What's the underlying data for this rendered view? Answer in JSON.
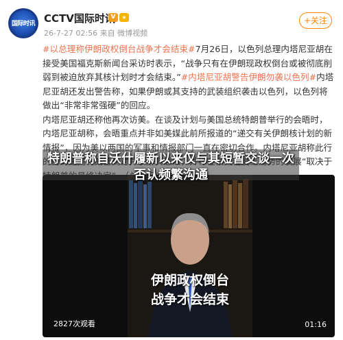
{
  "account": {
    "name": "CCTV国际时讯",
    "avatar_text": "国际时讯",
    "meta": "26-7-27 02:56 来自 微博视频",
    "follow_label": "+关注"
  },
  "post": {
    "tag1": "#以总理称伊朗政权倒台战争才会结束#",
    "p1a": "7月26日，以色列总理内塔尼亚胡在接受美国福克斯新闻台采访时表示，“战争只有在伊朗现政权倒台或被彻底削弱到被迫放弃其核计划时才会结束。”",
    "tag2": "#内塔尼亚胡警告伊朗勿袭以色列#",
    "p1b": "内塔尼亚胡还发出警告称，如果伊朗或其支持的武装组织袭击以色列，以色列将做出“非常非常强硬”的回应。",
    "p2": "内塔尼亚胡还称他再次访美。在谈及计划与美国总统特朗普举行的会晤时，内塔尼亚胡称，会晤重点并非如美媒此前所报道的“递交有关伊朗核计划的新情报”，因为美以两国的军事和情报部门一直在密切合作。内塔尼亚胡称此行的目的是同特朗普商讨并了解其想法，并称在很大程度上局势的发展“取决于特朗普的最终决定”。（总台记者 周..."
  },
  "overlay": {
    "headline": "特朗普称自沃什履新以来仅与其短暂交谈一次 否认频繁沟通"
  },
  "video": {
    "caption": "伊朗政权倒台战争才会结束",
    "caption_line1": "伊朗政权倒台",
    "caption_line2": "战争才会结束",
    "views": "2827次观看",
    "duration": "01:16"
  }
}
